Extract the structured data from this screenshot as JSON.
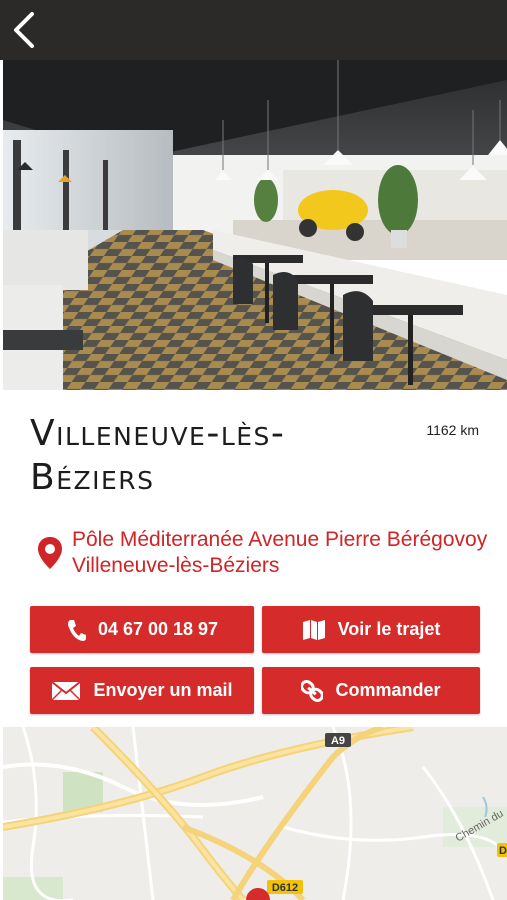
{
  "header": {
    "back_icon": "chevron-left-icon"
  },
  "place": {
    "name": "Villeneuve-lès-Béziers",
    "distance": "1162 km",
    "address": "Pôle Méditerranée Avenue Pierre Bérégovoy Villeneuve-lès-Béziers"
  },
  "actions": {
    "phone_label": "04 67 00 18 97",
    "route_label": "Voir le trajet",
    "mail_label": "Envoyer un mail",
    "order_label": "Commander"
  },
  "map": {
    "road_a9": "A9",
    "road_d612": "D612",
    "road_chemin": "Chemin du",
    "road_d_partial": "D"
  },
  "colors": {
    "accent": "#d52b2b",
    "topbar": "#2c2a29",
    "address": "#d02426"
  }
}
